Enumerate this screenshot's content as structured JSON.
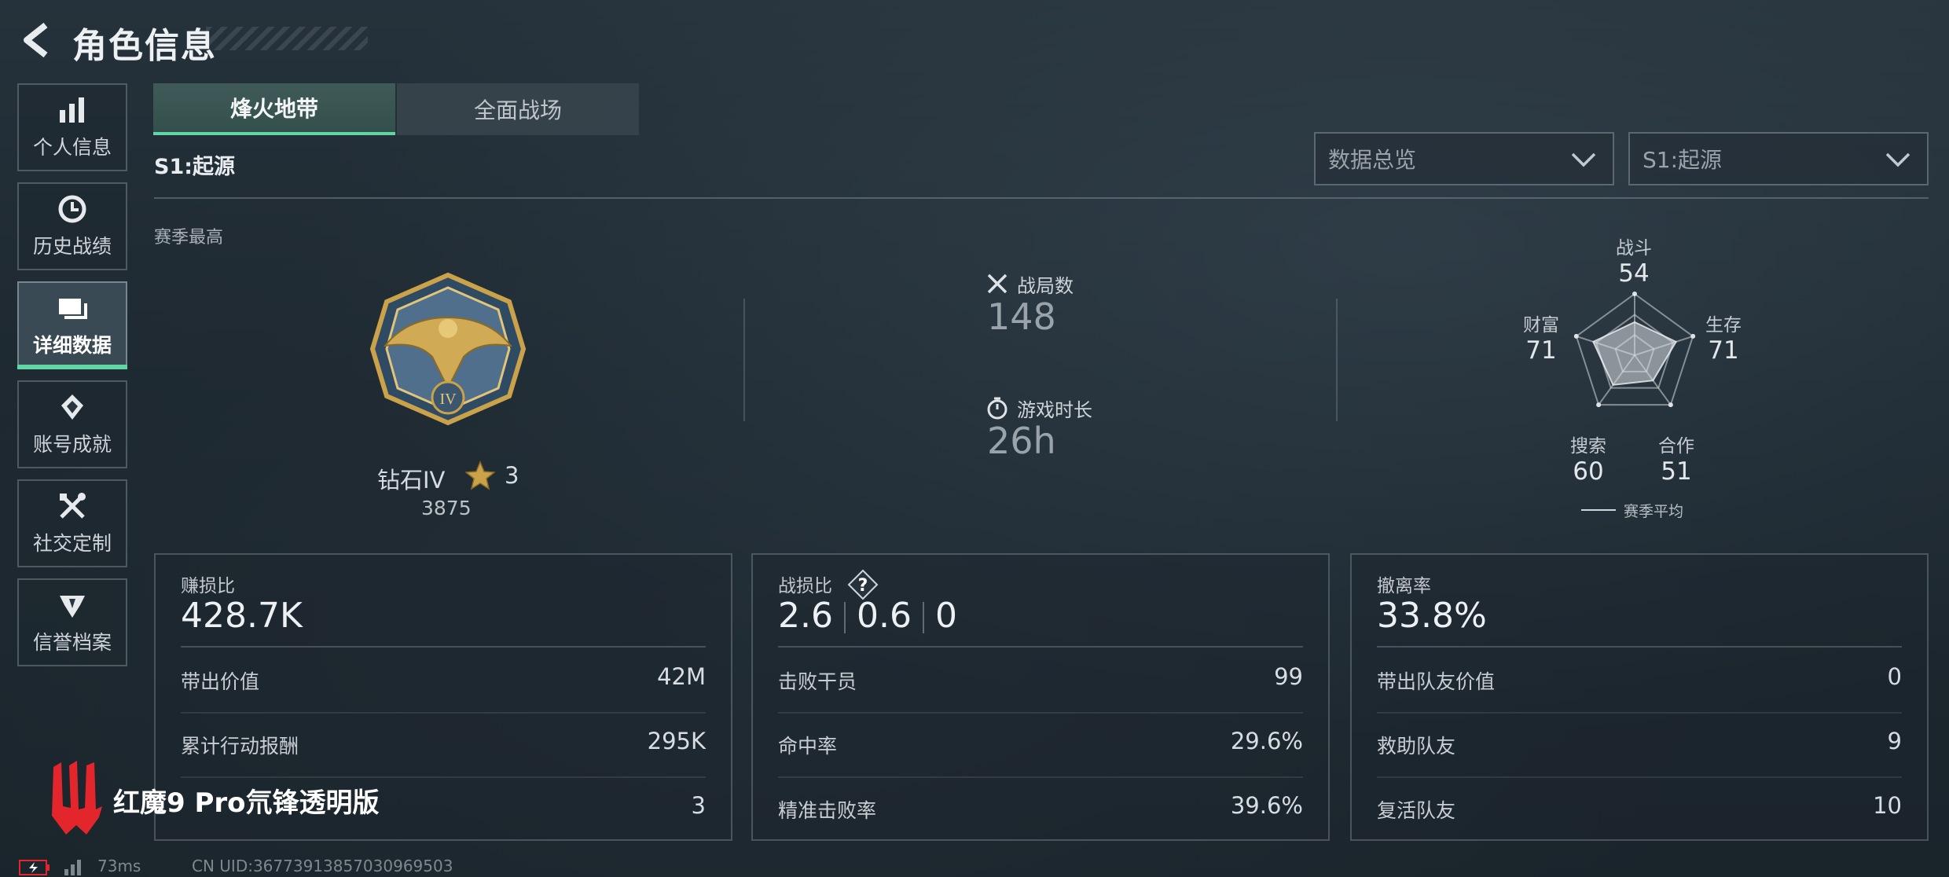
{
  "header": {
    "title": "角色信息"
  },
  "sidebar": {
    "items": [
      {
        "label": "个人信息",
        "icon": "bar-chart-icon",
        "active": false
      },
      {
        "label": "历史战绩",
        "icon": "history-clock-icon",
        "active": false
      },
      {
        "label": "详细数据",
        "icon": "cards-icon",
        "active": true
      },
      {
        "label": "账号成就",
        "icon": "achievement-icon",
        "active": false
      },
      {
        "label": "社交定制",
        "icon": "tools-icon",
        "active": false
      },
      {
        "label": "信誉档案",
        "icon": "credit-shield-icon",
        "active": false
      }
    ]
  },
  "tabs": [
    {
      "label": "烽火地带",
      "active": true
    },
    {
      "label": "全面战场",
      "active": false
    }
  ],
  "season": {
    "label": "S1:起源"
  },
  "filters": {
    "view": {
      "value": "数据总览"
    },
    "season": {
      "value": "S1:起源"
    }
  },
  "overview": {
    "section_label": "赛季最高",
    "rank": {
      "name": "钻石IV",
      "stars": "3",
      "score": "3875"
    },
    "matches": {
      "label": "战局数",
      "value": "148"
    },
    "playtime": {
      "label": "游戏时长",
      "value": "26h"
    },
    "radar": {
      "axes": [
        {
          "label": "战斗",
          "value": "54"
        },
        {
          "label": "生存",
          "value": "71"
        },
        {
          "label": "合作",
          "value": "51"
        },
        {
          "label": "搜索",
          "value": "60"
        },
        {
          "label": "财富",
          "value": "71"
        }
      ],
      "legend": "赛季平均"
    }
  },
  "cards": [
    {
      "title": "赚损比",
      "value": "428.7K",
      "rows": [
        {
          "label": "带出价值",
          "value": "42M"
        },
        {
          "label": "累计行动报酬",
          "value": "295K"
        },
        {
          "label": "",
          "value": "3"
        }
      ]
    },
    {
      "title": "战损比",
      "values": [
        "2.6",
        "0.6",
        "0"
      ],
      "rows": [
        {
          "label": "击败干员",
          "value": "99"
        },
        {
          "label": "命中率",
          "value": "29.6%"
        },
        {
          "label": "精准击败率",
          "value": "39.6%"
        }
      ]
    },
    {
      "title": "撤离率",
      "value": "33.8%",
      "rows": [
        {
          "label": "带出队友价值",
          "value": "0"
        },
        {
          "label": "救助队友",
          "value": "9"
        },
        {
          "label": "复活队友",
          "value": "10"
        }
      ]
    }
  ],
  "watermark": {
    "text": "红魔9 Pro氘锋透明版"
  },
  "footer": {
    "ping": "73ms",
    "uid": "CN UID:36773913857030969503"
  },
  "colors": {
    "accent": "#5fd6a4",
    "gold": "#c9a24a"
  }
}
